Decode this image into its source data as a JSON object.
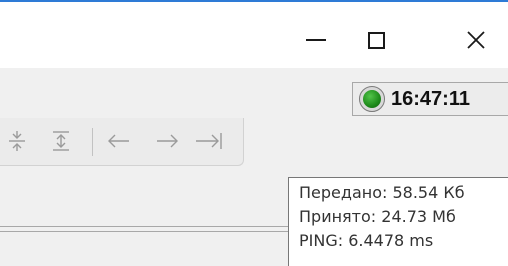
{
  "window_controls": {
    "minimize_icon": "minimize-icon",
    "maximize_icon": "maximize-icon",
    "close_icon": "close-icon",
    "close_glyph": "✕"
  },
  "status": {
    "time": "16:47:11",
    "indicator_color": "#1d8a1a"
  },
  "toolbar": {
    "icons": [
      "collapse-all-icon",
      "expand-all-icon",
      "arrow-left-icon",
      "arrow-right-icon",
      "arrow-to-end-icon"
    ]
  },
  "tooltip": {
    "sent": "Передано: 58.54 Кб",
    "received": "Принято: 24.73 Мб",
    "ping": "PING: 6.4478 ms"
  },
  "colors": {
    "accent_line": "#2e7bd6",
    "toolbar_bg": "#f0f0f0"
  }
}
